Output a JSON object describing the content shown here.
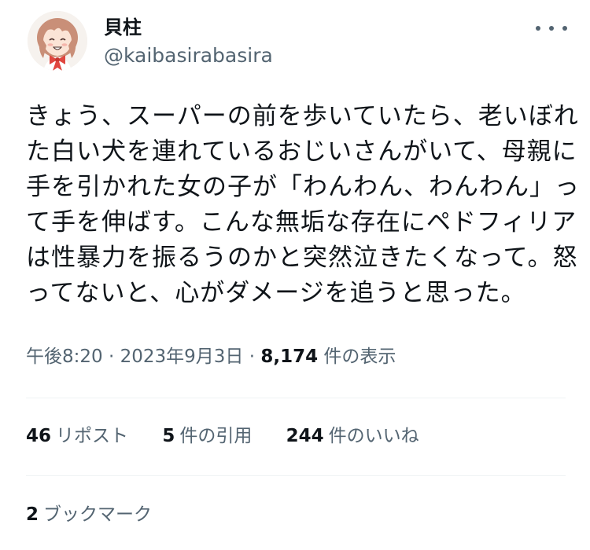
{
  "user": {
    "display_name": "貝柱",
    "handle": "@kaibasirabasira",
    "avatar_icon": "anime-girl-avatar"
  },
  "tweet": {
    "text_lines": [
      "きょう、スーパーの前を歩いていたら、老いぼれ",
      "た白い犬を連れているおじいさんがいて、母親に",
      "手を引かれた女の子が「わんわん、わんわん」っ",
      "て手を伸ばす。こんな無垢な存在にペドフィリア",
      "は性暴力を振るうのかと突然泣きたくなって。怒",
      "ってないと、心がダメージを追うと思った。"
    ],
    "time": "午後8:20",
    "dot1": "·",
    "date": "2023年9月3日",
    "dot2": "·",
    "views_count": "8,174",
    "views_label": "件の表示"
  },
  "stats": {
    "reposts_count": "46",
    "reposts_label": "リポスト",
    "quotes_count": "5",
    "quotes_label": "件の引用",
    "likes_count": "244",
    "likes_label": "件のいいね",
    "bookmarks_count": "2",
    "bookmarks_label": "ブックマーク"
  },
  "icons": {
    "more": "more-dots-icon"
  },
  "colors": {
    "text_primary": "#0f1419",
    "text_secondary": "#536471",
    "divider": "#eff3f4"
  }
}
